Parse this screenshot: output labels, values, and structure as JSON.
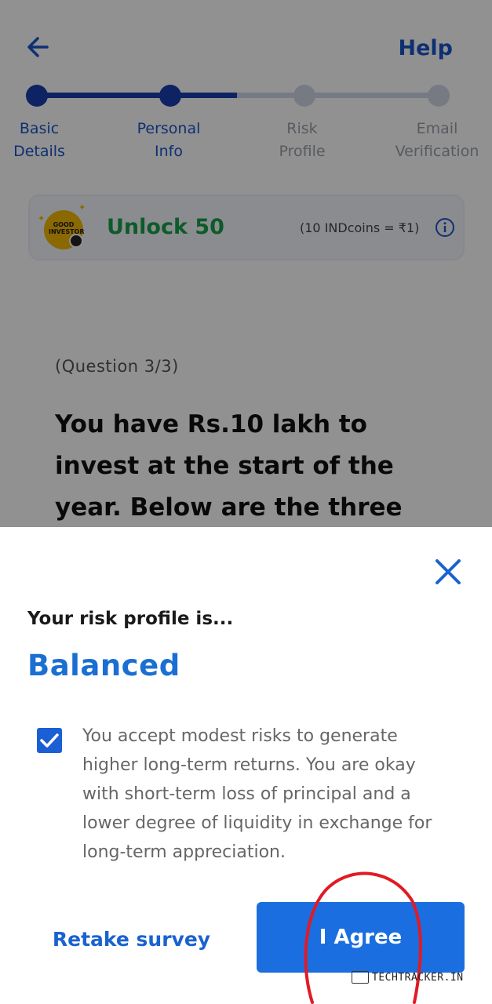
{
  "header": {
    "back_icon": "arrow-left-icon",
    "help_label": "Help"
  },
  "stepper": {
    "steps": [
      {
        "line1": "Basic",
        "line2": "Details",
        "state": "completed"
      },
      {
        "line1": "Personal",
        "line2": "Info",
        "state": "completed"
      },
      {
        "line1": "Risk",
        "line2": "Profile",
        "state": "pending"
      },
      {
        "line1": "Email",
        "line2": "Verification",
        "state": "pending"
      }
    ],
    "progress_fraction": 0.47
  },
  "banner": {
    "logo_text": "GOOD INVESTOR",
    "unlock_text": "Unlock 50",
    "coin_rate": "(10 INDcoins = ₹1)",
    "info_icon": "info-icon"
  },
  "question": {
    "count": "(Question 3/3)",
    "text_lines": [
      "You have Rs.10 lakh to",
      "invest at the start of the",
      "year. Below are the three"
    ]
  },
  "sheet": {
    "close_icon": "close-icon",
    "subtitle": "Your risk profile is...",
    "profile": "Balanced",
    "checkbox_checked": true,
    "description_lines": [
      "You accept modest risks to generate",
      "higher long-term returns. You are okay",
      "with short-term loss of principal and a",
      "lower degree of liquidity in exchange for",
      "long-term appreciation."
    ],
    "retake_label": "Retake survey",
    "agree_label": "I Agree"
  },
  "watermark": "TECHTRACKER.IN",
  "colors": {
    "primary": "#1a6ee0",
    "dark_blue": "#1a3fae",
    "profile_blue": "#1a6fd2",
    "green": "#17a04a",
    "annotation_red": "#e01b24"
  }
}
